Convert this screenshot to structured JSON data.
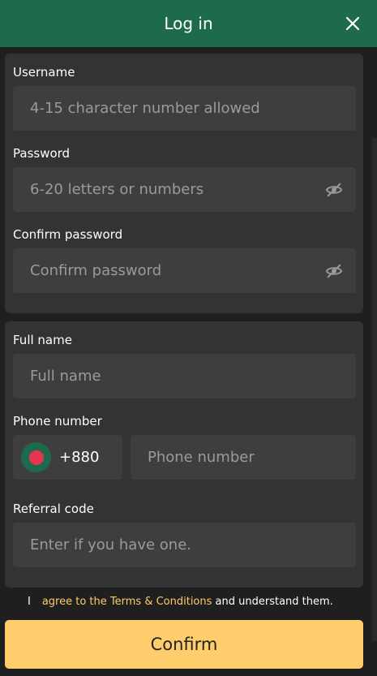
{
  "header": {
    "title": "Log in",
    "close_icon": "close-icon"
  },
  "account": {
    "username": {
      "label": "Username",
      "placeholder": "4-15 character number allowed",
      "value": ""
    },
    "password": {
      "label": "Password",
      "placeholder": "6-20 letters or numbers",
      "value": "",
      "toggle_icon": "eye-slash-icon"
    },
    "confirm_password": {
      "label": "Confirm password",
      "placeholder": "Confirm password",
      "value": "",
      "toggle_icon": "eye-slash-icon"
    }
  },
  "profile": {
    "full_name": {
      "label": "Full name",
      "placeholder": "Full name",
      "value": ""
    },
    "phone": {
      "label": "Phone number",
      "country_code": "+880",
      "flag_icon": "bangladesh-flag-icon",
      "placeholder": "Phone number",
      "value": ""
    },
    "referral": {
      "label": "Referral code",
      "placeholder": "Enter if you have one.",
      "value": ""
    }
  },
  "terms": {
    "checkbox_glyph": "I",
    "link_text": "agree to the Terms & Conditions",
    "suffix": " and understand them."
  },
  "confirm_label": "Confirm",
  "colors": {
    "header_bg": "#1d6b4c",
    "page_bg": "#1f1f1f",
    "card_bg": "#333333",
    "input_bg": "#3e3e3e",
    "accent": "#ffcd6b",
    "link": "#ffca6b",
    "flag_red": "#e8344e"
  }
}
